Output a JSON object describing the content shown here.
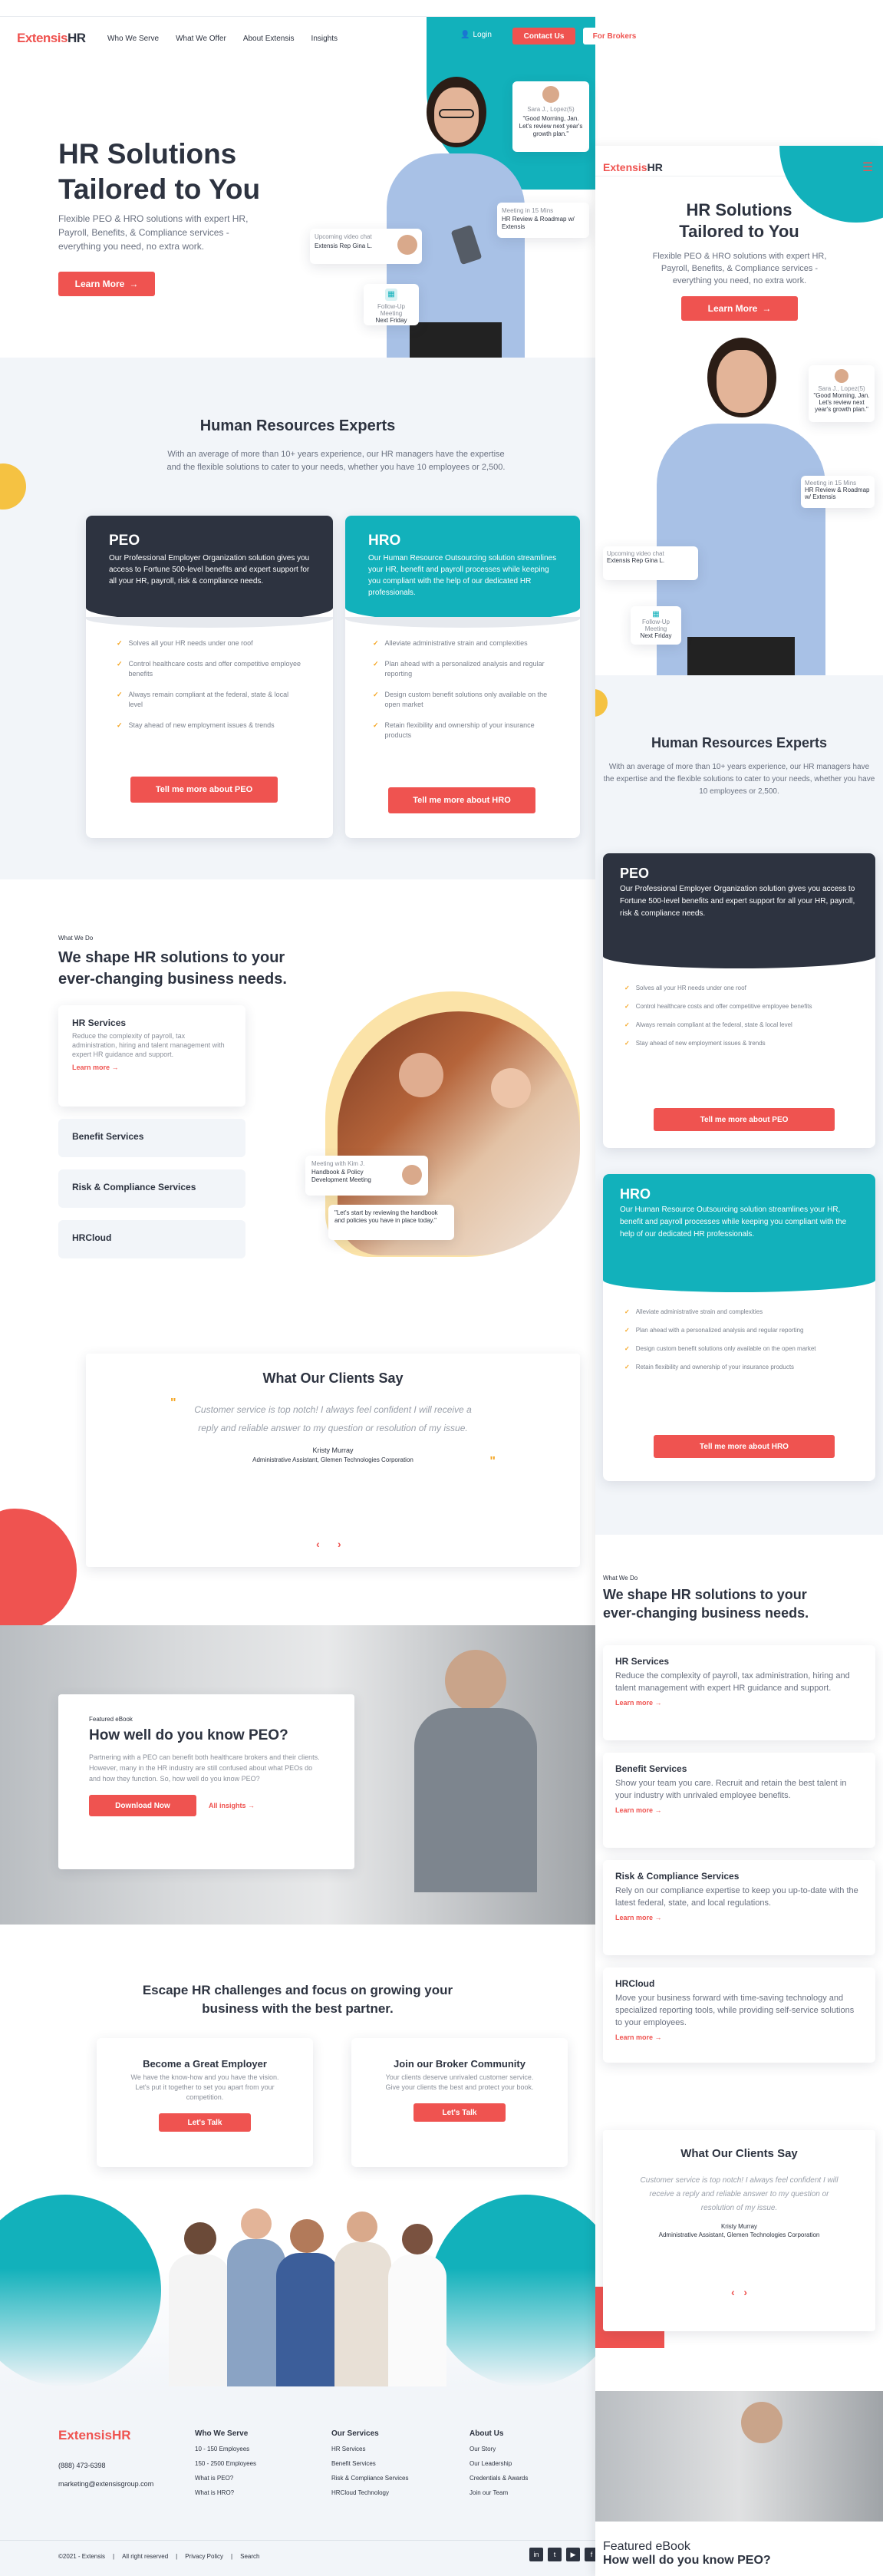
{
  "brand": {
    "extensis": "Extensis",
    "hr": "HR"
  },
  "nav": {
    "items": [
      "Who We Serve",
      "What We Offer",
      "About Extensis",
      "Insights"
    ],
    "login": "Login",
    "contact": "Contact Us",
    "brokers": "For Brokers"
  },
  "hero": {
    "title_line1": "HR Solutions",
    "title_line2": "Tailored to You",
    "subtitle": "Flexible PEO & HRO solutions with expert HR, Payroll, Benefits, & Compliance services - everything you need, no extra work.",
    "cta": "Learn More",
    "bubble_name": "Sara J., Lopez(5)",
    "bubble_text": "\"Good Morning, Jan. Let's review next year's growth plan.\"",
    "meeting_label": "Meeting in 15 Mins",
    "meeting_text": "HR Review & Roadmap w/ Extensis",
    "upcoming_label": "Upcoming video chat",
    "upcoming_text": "Extensis Rep Gina L.",
    "followup_label": "Follow-Up Meeting",
    "followup_text": "Next Friday"
  },
  "experts": {
    "title": "Human Resources Experts",
    "text": "With an average of more than 10+ years experience, our HR managers have the expertise and the flexible solutions to cater to your needs, whether you have 10 employees or 2,500.",
    "text_mobile": "With an average of more than 10+ years experience, our HR managers have the expertise and the flexible solutions to cater to your needs, whether you have 10 employees or 2,500."
  },
  "peo": {
    "title": "PEO",
    "desc": "Our Professional Employer Organization solution gives you access to Fortune 500-level benefits and expert support for all your HR, payroll, risk & compliance needs.",
    "items": [
      "Solves all your HR needs under one roof",
      "Control healthcare costs and offer competitive employee benefits",
      "Always remain compliant at the federal, state & local level",
      "Stay ahead of new employment issues & trends"
    ],
    "cta": "Tell me more about PEO"
  },
  "hro": {
    "title": "HRO",
    "desc": "Our Human Resource Outsourcing solution streamlines your HR, benefit and payroll processes while keeping you compliant with the help of our dedicated HR professionals.",
    "items": [
      "Alleviate administrative strain and complexities",
      "Plan ahead with a personalized analysis and regular reporting",
      "Design custom benefit solutions only available on the open market",
      "Retain flexibility and ownership of your insurance products"
    ],
    "cta": "Tell me more about HRO"
  },
  "whatwedo": {
    "eyebrow": "What We Do",
    "title_line1": "We shape HR solutions to your",
    "title_line2": "ever-changing business needs.",
    "hr_title": "HR Services",
    "hr_text": "Reduce the complexity of payroll, tax administration, hiring and talent management with expert HR guidance and support.",
    "learn": "Learn more",
    "benefit_title": "Benefit Services",
    "benefit_text": "Show your team you care. Recruit and retain the best talent in your industry with unrivaled employee benefits.",
    "risk_title": "Risk & Compliance Services",
    "risk_text": "Rely on our compliance expertise to keep you up-to-date with the latest federal, state, and local regulations.",
    "hrcloud_title": "HRCloud",
    "hrcloud_text": "Move your business forward with time-saving technology and specialized reporting tools, while providing self-service solutions to your employees.",
    "meet_label": "Meeting with Kim J.",
    "meet_text": "Handbook & Policy Development Meeting",
    "quote": "\"Let's start by reviewing the handbook and policies you have in place today.\""
  },
  "testimonial": {
    "title": "What Our Clients Say",
    "quote": "Customer service is top notch! I always feel confident I will receive a reply and reliable answer to my question or resolution of my issue.",
    "name": "Kristy Murray",
    "role": "Administrative Assistant, Glemen Technologies Corporation"
  },
  "ebook": {
    "eyebrow": "Featured eBook",
    "title": "How well do you know PEO?",
    "text": "Partnering with a PEO can benefit both healthcare brokers and their clients. However, many in the HR industry are still confused about what PEOs do and how they function. So, how well do you know PEO?",
    "download": "Download Now",
    "all": "All insights"
  },
  "escape": {
    "title_line1": "Escape HR challenges and focus on growing your",
    "title_line2": "business with the best partner.",
    "emp_title": "Become a Great Employer",
    "emp_text": "We have the know-how and you have the vision. Let's put it together to set you apart from your competition.",
    "broker_title": "Join our Broker Community",
    "broker_text": "Your clients deserve unrivaled customer service. Give your clients the best and protect your book.",
    "talk": "Let's Talk"
  },
  "footer": {
    "phone": "(888) 473-6398",
    "email": "marketing@extensisgroup.com",
    "col1_title": "Who We Serve",
    "col1": [
      "10 - 150 Employees",
      "150 - 2500 Employees",
      "What is PEO?",
      "What is HRO?"
    ],
    "col2_title": "Our Services",
    "col2": [
      "HR Services",
      "Benefit Services",
      "Risk & Compliance Services",
      "HRCloud Technology"
    ],
    "col3_title": "About Us",
    "col3": [
      "Our Story",
      "Our Leadership",
      "Credentials & Awards",
      "Join our Team"
    ],
    "copyright": "©2021 - Extensis",
    "rights": "All right reserved",
    "privacy": "Privacy Policy",
    "search": "Search",
    "social": [
      "in",
      "t",
      "▶",
      "f"
    ]
  },
  "mobile": {
    "ebook_eyebrow": "Featured eBook",
    "ebook_title": "How well do you know PEO?"
  },
  "colors": {
    "coral": "#ef5350",
    "teal": "#12b1bb",
    "navy": "#2d3340",
    "yellow": "#f5c242"
  }
}
